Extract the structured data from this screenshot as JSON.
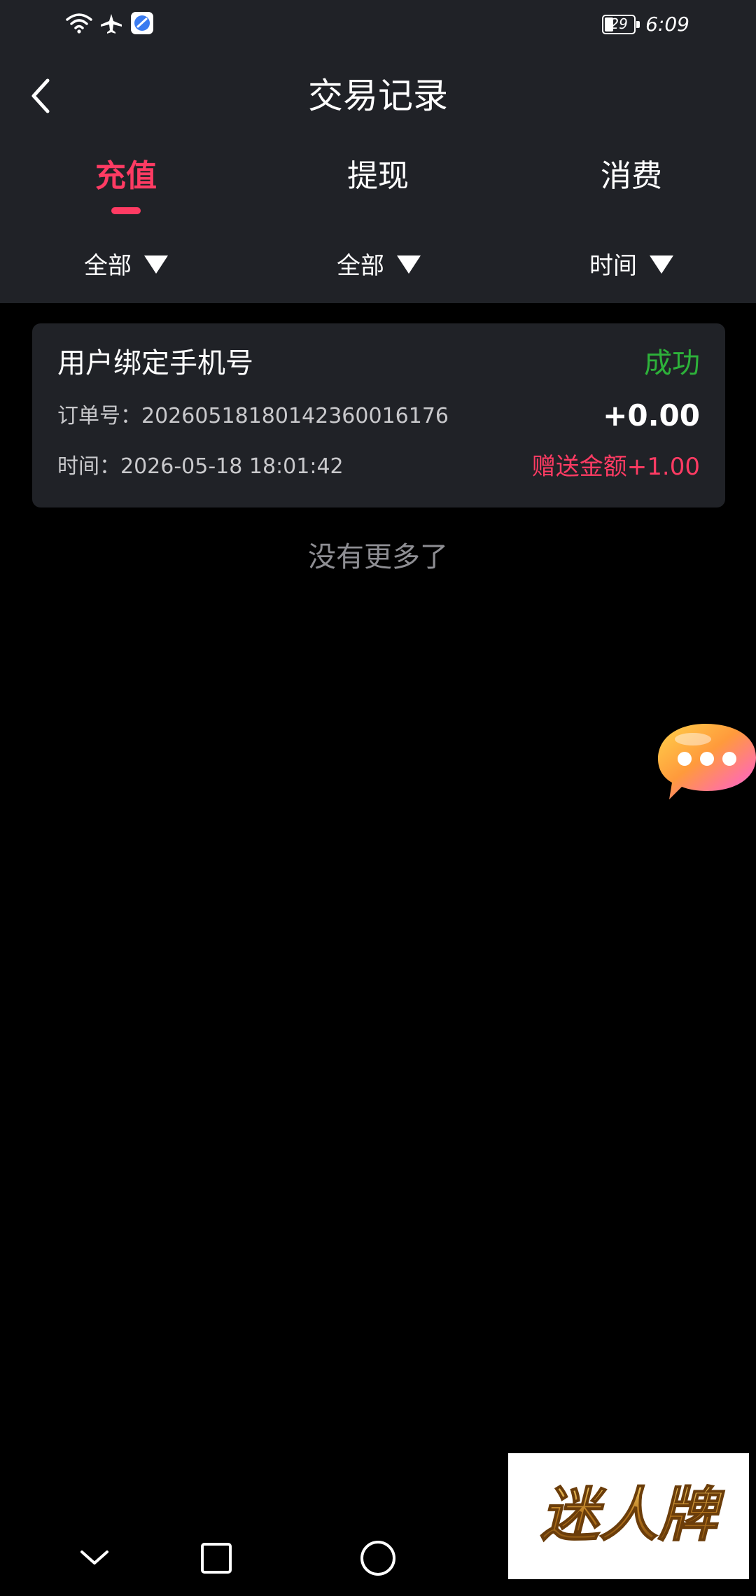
{
  "status_bar": {
    "battery_level": "29",
    "time": "6:09",
    "icons": [
      "wifi-icon",
      "airplane-icon",
      "app-notification-icon"
    ]
  },
  "header": {
    "title": "交易记录",
    "back_icon": "chevron-left-icon"
  },
  "tabs": [
    {
      "label": "充值",
      "active": true
    },
    {
      "label": "提现",
      "active": false
    },
    {
      "label": "消费",
      "active": false
    }
  ],
  "filters": [
    {
      "label": "全部",
      "icon": "caret-down-icon"
    },
    {
      "label": "全部",
      "icon": "caret-down-icon"
    },
    {
      "label": "时间",
      "icon": "caret-down-icon"
    }
  ],
  "transactions": [
    {
      "title": "用户绑定手机号",
      "status": "成功",
      "order": "订单号：20260518180142360016176",
      "amount": "+0.00",
      "time": "时间：2026-05-18 18:01:42",
      "bonus": "赠送金额+1.00"
    }
  ],
  "list_footer": "没有更多了",
  "watermark": "迷人牌",
  "nav_bar": [
    "back-nav-icon",
    "recents-icon",
    "home-icon"
  ],
  "colors": {
    "header_bg": "#202227",
    "accent": "#ff3b63",
    "success": "#2db23a",
    "muted_text": "#8e8e93"
  }
}
